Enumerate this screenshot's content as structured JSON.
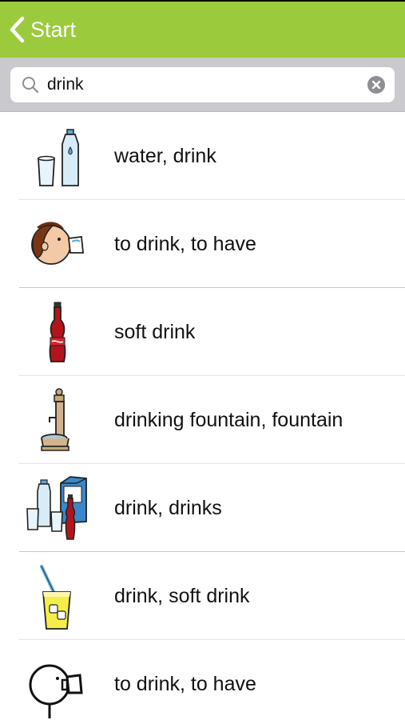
{
  "header": {
    "back_label": "Start",
    "background_color": "#9bcb3c"
  },
  "search": {
    "value": "drink",
    "icon": "search-icon",
    "clear_icon": "clear-icon"
  },
  "results": [
    {
      "label": "water, drink",
      "icon": "water-bottle-glass-icon"
    },
    {
      "label": "to drink, to have",
      "icon": "person-drinking-icon"
    },
    {
      "label": "soft drink",
      "icon": "cola-bottle-icon"
    },
    {
      "label": "drinking fountain, fountain",
      "icon": "drinking-fountain-icon"
    },
    {
      "label": "drink, drinks",
      "icon": "assorted-drinks-icon"
    },
    {
      "label": "drink, soft drink",
      "icon": "glass-with-straw-icon"
    },
    {
      "label": "to drink, to have",
      "icon": "outline-person-drinking-icon"
    }
  ]
}
